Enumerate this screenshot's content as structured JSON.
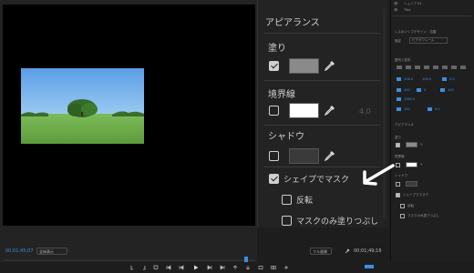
{
  "monitor": {
    "timecode_left": "00;01;45;07",
    "fit_label": "全体表示",
    "full_label": "フル画質",
    "timecode_right": "00;01;49;16"
  },
  "essential": {
    "title": "アピアランス",
    "fill_label": "塗り",
    "fill_checked": true,
    "fill_color": "#8a8a8a",
    "stroke_label": "境界線",
    "stroke_checked": false,
    "stroke_color": "#ffffff",
    "stroke_width": "4.0",
    "shadow_label": "シャドウ",
    "shadow_checked": false,
    "shadow_color": "#3a3a3a",
    "mask_label": "シェイプでマスク",
    "mask_checked": true,
    "invert_label": "反転",
    "invert_checked": false,
    "fill_only_label": "マスクのみ塗りつぶし",
    "fill_only_checked": false
  },
  "right_panel": {
    "layer1": "シェイプ 01",
    "layer2": "Title",
    "responsive_label": "レスポンシブデザイン - 位置",
    "pin_label": "固定",
    "pin_value": "ビデオフレーム",
    "align_label": "整列と変形",
    "appearance_label": "アピアランス",
    "fill_label": "塗り",
    "stroke_label": "境界線",
    "shadow_label": "シャドウ",
    "mask_label": "シェイプでマスク",
    "invert_label": "反転",
    "fill_only_label": "マスクのみ塗りつぶし",
    "nums": [
      "208.0",
      "108.0",
      "100",
      "0",
      "0.0",
      "1080.0",
      "100",
      "100",
      "0.0"
    ]
  },
  "colors": {
    "accent": "#3d8ee0",
    "sky": "#6fb0ee",
    "grass": "#6aa84a"
  }
}
